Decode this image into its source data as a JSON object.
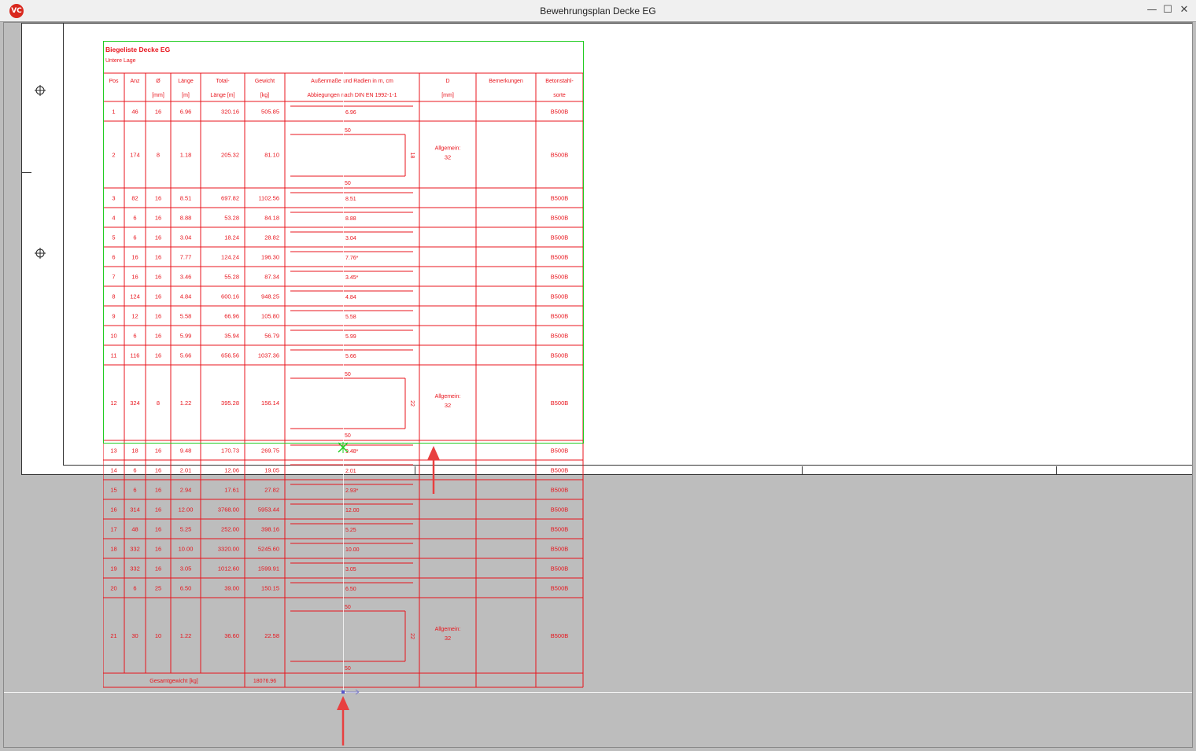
{
  "window": {
    "title": "Bewehrungsplan Decke EG",
    "app_icon": "VC",
    "minimize": "—",
    "maximize": "☐",
    "close": "✕"
  },
  "schedule": {
    "title": "Biegeliste Decke EG",
    "subtitle": "Untere Lage",
    "headers": {
      "pos": "Pos",
      "anz": "Anz",
      "dia": [
        "Ø",
        "[mm]"
      ],
      "laenge": [
        "Länge",
        "[m]"
      ],
      "total": [
        "Total-",
        "Länge [m]"
      ],
      "gewicht": [
        "Gewicht",
        "[kg]"
      ],
      "form": [
        "Außenmaße und Radien in m, cm",
        "Abbiegungen nach DIN EN 1992-1-1"
      ],
      "d": [
        "D",
        "[mm]"
      ],
      "bem": "Bemerkungen",
      "sorte": [
        "Betonstahl-",
        "sorte"
      ]
    },
    "rows": [
      {
        "pos": "1",
        "anz": "46",
        "dia": "16",
        "len": "6.96",
        "total": "320.16",
        "weight": "505.85",
        "shape": "straight",
        "label": "6.96",
        "d": "",
        "sorte": "B500B"
      },
      {
        "pos": "2",
        "anz": "174",
        "dia": "8",
        "len": "1.18",
        "total": "205.32",
        "weight": "81.10",
        "shape": "stirrup",
        "top": "50",
        "bottom": "50",
        "side": "18",
        "d": "Allgemein:|32",
        "sorte": "B500B"
      },
      {
        "pos": "3",
        "anz": "82",
        "dia": "16",
        "len": "8.51",
        "total": "697.82",
        "weight": "1102.56",
        "shape": "straight",
        "label": "8.51",
        "d": "",
        "sorte": "B500B"
      },
      {
        "pos": "4",
        "anz": "6",
        "dia": "16",
        "len": "8.88",
        "total": "53.28",
        "weight": "84.18",
        "shape": "straight",
        "label": "8.88",
        "d": "",
        "sorte": "B500B"
      },
      {
        "pos": "5",
        "anz": "6",
        "dia": "16",
        "len": "3.04",
        "total": "18.24",
        "weight": "28.82",
        "shape": "straight",
        "label": "3.04",
        "d": "",
        "sorte": "B500B"
      },
      {
        "pos": "6",
        "anz": "16",
        "dia": "16",
        "len": "7.77",
        "total": "124.24",
        "weight": "196.30",
        "shape": "straight",
        "label": "7.76*",
        "d": "",
        "sorte": "B500B"
      },
      {
        "pos": "7",
        "anz": "16",
        "dia": "16",
        "len": "3.46",
        "total": "55.28",
        "weight": "87.34",
        "shape": "straight",
        "label": "3.45*",
        "d": "",
        "sorte": "B500B"
      },
      {
        "pos": "8",
        "anz": "124",
        "dia": "16",
        "len": "4.84",
        "total": "600.16",
        "weight": "948.25",
        "shape": "straight",
        "label": "4.84",
        "d": "",
        "sorte": "B500B"
      },
      {
        "pos": "9",
        "anz": "12",
        "dia": "16",
        "len": "5.58",
        "total": "66.96",
        "weight": "105.80",
        "shape": "straight",
        "label": "5.58",
        "d": "",
        "sorte": "B500B"
      },
      {
        "pos": "10",
        "anz": "6",
        "dia": "16",
        "len": "5.99",
        "total": "35.94",
        "weight": "56.79",
        "shape": "straight",
        "label": "5.99",
        "d": "",
        "sorte": "B500B"
      },
      {
        "pos": "11",
        "anz": "116",
        "dia": "16",
        "len": "5.66",
        "total": "656.56",
        "weight": "1037.36",
        "shape": "straight",
        "label": "5.66",
        "d": "",
        "sorte": "B500B"
      },
      {
        "pos": "12",
        "anz": "324",
        "dia": "8",
        "len": "1.22",
        "total": "395.28",
        "weight": "156.14",
        "shape": "stirrup",
        "top": "50",
        "bottom": "50",
        "side": "22",
        "d": "Allgemein:|32",
        "sorte": "B500B"
      },
      {
        "pos": "13",
        "anz": "18",
        "dia": "16",
        "len": "9.48",
        "total": "170.73",
        "weight": "269.75",
        "shape": "straight",
        "label": "9.48*",
        "d": "",
        "sorte": "B500B"
      },
      {
        "pos": "14",
        "anz": "6",
        "dia": "16",
        "len": "2.01",
        "total": "12.06",
        "weight": "19.05",
        "shape": "straight",
        "label": "2.01",
        "d": "",
        "sorte": "B500B"
      },
      {
        "pos": "15",
        "anz": "6",
        "dia": "16",
        "len": "2.94",
        "total": "17.61",
        "weight": "27.82",
        "shape": "straight",
        "label": "2.93*",
        "d": "",
        "sorte": "B500B"
      },
      {
        "pos": "16",
        "anz": "314",
        "dia": "16",
        "len": "12.00",
        "total": "3768.00",
        "weight": "5953.44",
        "shape": "straight",
        "label": "12.00",
        "d": "",
        "sorte": "B500B"
      },
      {
        "pos": "17",
        "anz": "48",
        "dia": "16",
        "len": "5.25",
        "total": "252.00",
        "weight": "398.16",
        "shape": "straight",
        "label": "5.25",
        "d": "",
        "sorte": "B500B"
      },
      {
        "pos": "18",
        "anz": "332",
        "dia": "16",
        "len": "10.00",
        "total": "3320.00",
        "weight": "5245.60",
        "shape": "straight",
        "label": "10.00",
        "d": "",
        "sorte": "B500B"
      },
      {
        "pos": "19",
        "anz": "332",
        "dia": "16",
        "len": "3.05",
        "total": "1012.60",
        "weight": "1599.91",
        "shape": "straight",
        "label": "3.05",
        "d": "",
        "sorte": "B500B"
      },
      {
        "pos": "20",
        "anz": "6",
        "dia": "25",
        "len": "6.50",
        "total": "39.00",
        "weight": "150.15",
        "shape": "straight",
        "label": "6.50",
        "d": "",
        "sorte": "B500B"
      },
      {
        "pos": "21",
        "anz": "30",
        "dia": "10",
        "len": "1.22",
        "total": "36.60",
        "weight": "22.58",
        "shape": "stirrup",
        "top": "50",
        "bottom": "50",
        "side": "22",
        "d": "Allgemein:|32",
        "sorte": "B500B"
      }
    ],
    "total_label": "Gesamtgewicht [kg]",
    "total_value": "18076.96"
  },
  "colors": {
    "table_red": "#e8141c",
    "selection_green": "#22cc22",
    "arrow_red": "#e84040",
    "canvas_gray": "#bdbdbd"
  }
}
